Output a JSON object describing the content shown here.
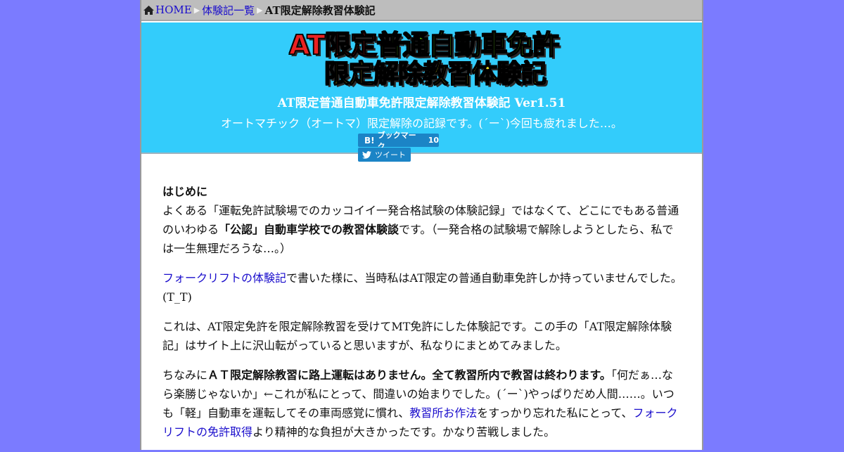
{
  "breadcrumb": {
    "home": "HOME",
    "list": "体験記一覧",
    "current": "AT限定解除教習体験記"
  },
  "logo": {
    "line1_red": "AT限定",
    "line1_green": "普通自動車免許",
    "line2": "限定解除教習体験記"
  },
  "site": {
    "title": "AT限定普通自動車免許限定解除教習体験記 Ver1.51",
    "subtitle": "オートマチック（オートマ）限定解除の記録です。(´ー`)今回も疲れました…。"
  },
  "share": {
    "hatena_mark": "B!",
    "hatena_label": "ブックマーク",
    "hatena_count": "10",
    "tweet_label": "ツイート"
  },
  "content": {
    "heading": "はじめに",
    "p1_a": "よくある「運転免許試験場でのカッコイイ一発合格試験の体験記録」ではなくて、どこにでもある普通のいわゆる",
    "p1_b": "「公認」自動車学校での教習体験談",
    "p1_c": "です。（一発合格の試験場で解除しようとしたら、私では一生無理だろうな…。）",
    "p2_link": "フォークリフトの体験記",
    "p2_rest": "で書いた様に、当時私はAT限定の普通自動車免許しか持っていませんでした。(T_T)",
    "p3": "これは、AT限定免許を限定解除教習を受けてMT免許にした体験記です。この手の「AT限定解除体験記」はサイト上に沢山転がっていると思いますが、私なりにまとめてみました。",
    "p4_a": "ちなみに",
    "p4_bold": "ＡＴ限定解除教習に路上運転はありません。全て教習所内で教習は終わります。",
    "p4_b": "「何だぁ…なら楽勝じゃないか」←これが私にとって、間違いの始まりでした。(´ー`)やっぱりだめ人間……。いつも「軽」自動車を運転してその車両感覚に慣れ、",
    "p4_link1": "教習所お作法",
    "p4_c": "をすっかり忘れた私にとって、",
    "p4_link2": "フォークリフトの免許取得",
    "p4_d": "より精神的な負担が大きかったです。かなり苦戦しました。"
  },
  "colors": {
    "background": "#7b7bff",
    "header": "#33ccfb",
    "breadcrumb_bar": "#bdbdbd",
    "link": "#1a0dcc",
    "share_button": "#1b84c6"
  },
  "icons": [
    "home-icon",
    "triangle-separator-icon",
    "twitter-bird-icon"
  ]
}
